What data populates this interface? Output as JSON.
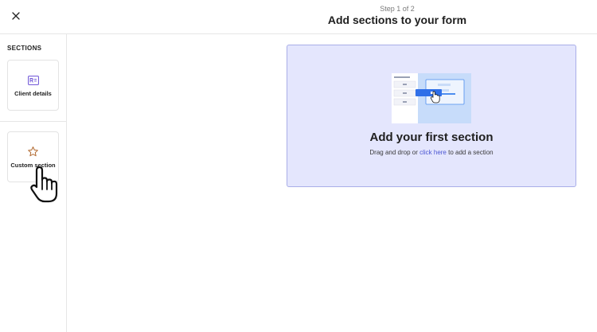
{
  "header": {
    "step": "Step 1 of 2",
    "title": "Add sections to your form",
    "close_icon": "close-icon"
  },
  "sidebar": {
    "heading": "SECTIONS",
    "items": [
      {
        "label": "Client details",
        "icon": "client-card-icon"
      },
      {
        "label": "Custom section",
        "icon": "star-icon"
      }
    ]
  },
  "drop_zone": {
    "title": "Add your first section",
    "desc_before": "Drag and drop or ",
    "desc_link": "click here",
    "desc_after": " to add a section"
  },
  "colors": {
    "accent": "#4b56d2",
    "drop_zone_bg": "#e4e6fd",
    "drop_zone_border": "#a9aee8",
    "client_icon": "#6a4fd6",
    "star_icon": "#b0672c"
  }
}
